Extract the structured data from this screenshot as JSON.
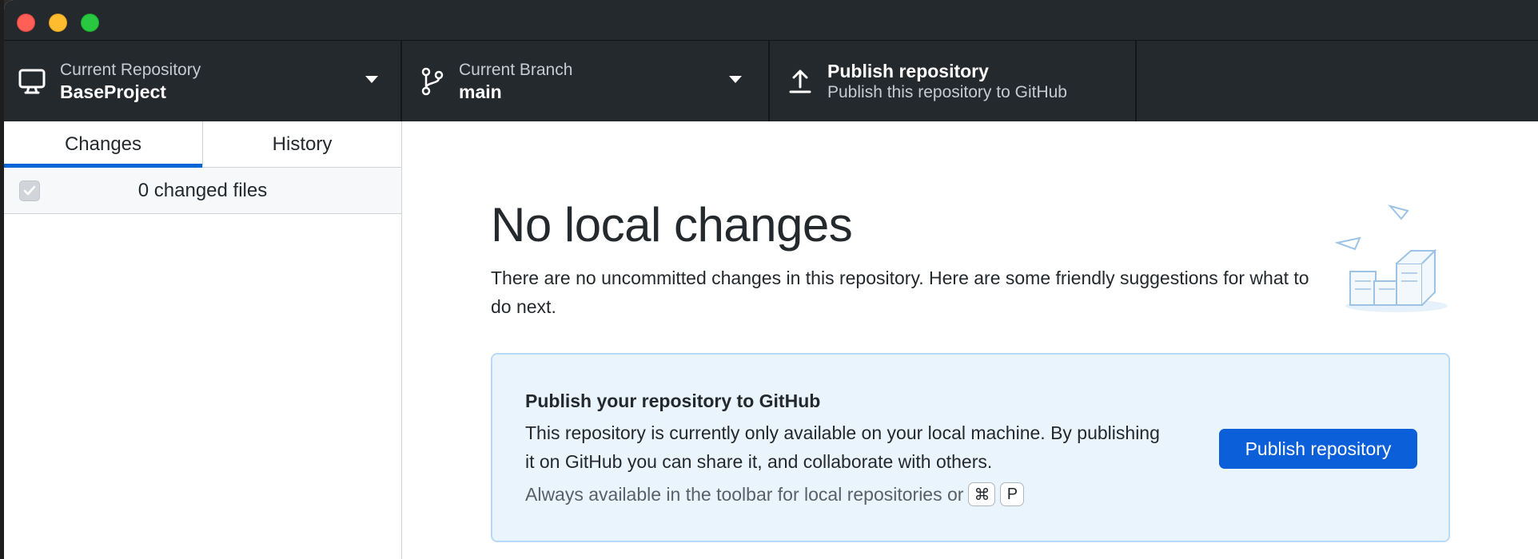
{
  "window": {
    "title": ""
  },
  "toolbar": {
    "repository": {
      "label": "Current Repository",
      "value": "BaseProject",
      "icon": "computer-icon"
    },
    "branch": {
      "label": "Current Branch",
      "value": "main",
      "icon": "git-branch-icon"
    },
    "publish": {
      "label": "Publish repository",
      "sublabel": "Publish this repository to GitHub",
      "icon": "upload-icon"
    }
  },
  "sidebar": {
    "tabs": [
      {
        "label": "Changes",
        "active": true
      },
      {
        "label": "History",
        "active": false
      }
    ],
    "changes_summary": "0 changed files"
  },
  "main": {
    "title": "No local changes",
    "description": "There are no uncommitted changes in this repository. Here are some friendly suggestions for what to do next.",
    "callout": {
      "title": "Publish your repository to GitHub",
      "body": "This repository is currently only available on your local machine. By publishing it on GitHub you can share it, and collaborate with others.",
      "hint": "Always available in the toolbar for local repositories or",
      "shortcut_keys": [
        "⌘",
        "P"
      ],
      "button_label": "Publish repository"
    }
  },
  "colors": {
    "toolbar_bg": "#24292e",
    "accent": "#0366d6",
    "callout_bg": "#eaf4fd",
    "callout_border": "#b6daf7"
  }
}
